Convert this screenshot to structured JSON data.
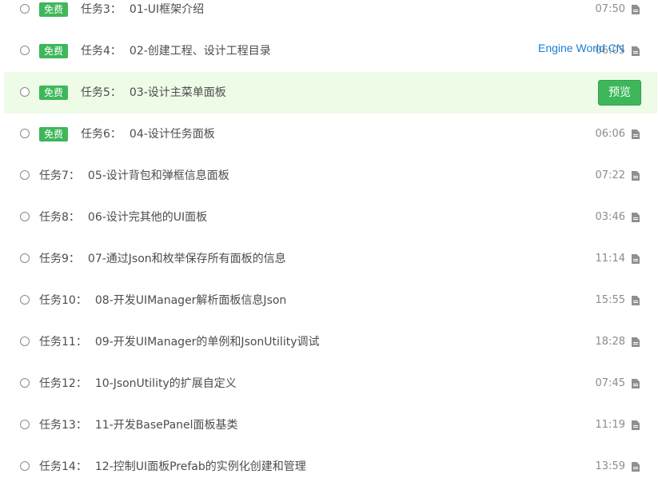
{
  "watermark": "Engine World  CN",
  "preview_label": "预览",
  "tasks": [
    {
      "num": "任务3：",
      "title": "01-UI框架介绍",
      "free": "免费",
      "duration": "07:50"
    },
    {
      "num": "任务4：",
      "title": "02-创建工程、设计工程目录",
      "free": "免费",
      "duration": "06:05"
    },
    {
      "num": "任务5：",
      "title": "03-设计主菜单面板",
      "free": "免费",
      "duration": ""
    },
    {
      "num": "任务6：",
      "title": "04-设计任务面板",
      "free": "免费",
      "duration": "06:06"
    },
    {
      "num": "任务7：",
      "title": "05-设计背包和弹框信息面板",
      "free": "",
      "duration": "07:22"
    },
    {
      "num": "任务8：",
      "title": "06-设计完其他的UI面板",
      "free": "",
      "duration": "03:46"
    },
    {
      "num": "任务9：",
      "title": "07-通过Json和枚举保存所有面板的信息",
      "free": "",
      "duration": "11:14"
    },
    {
      "num": "任务10：",
      "title": "08-开发UIManager解析面板信息Json",
      "free": "",
      "duration": "15:55"
    },
    {
      "num": "任务11：",
      "title": "09-开发UIManager的单例和JsonUtility调试",
      "free": "",
      "duration": "18:28"
    },
    {
      "num": "任务12：",
      "title": "10-JsonUtility的扩展自定义",
      "free": "",
      "duration": "07:45"
    },
    {
      "num": "任务13：",
      "title": "11-开发BasePanel面板基类",
      "free": "",
      "duration": "11:19"
    },
    {
      "num": "任务14：",
      "title": "12-控制UI面板Prefab的实例化创建和管理",
      "free": "",
      "duration": "13:59"
    }
  ],
  "colors": {
    "free_badge": "#3eb75a",
    "active_row_bg": "#eefbe7",
    "watermark": "#1b7fd1"
  },
  "icons": {
    "radio": "radio-unchecked-icon",
    "duration": "document-icon"
  }
}
